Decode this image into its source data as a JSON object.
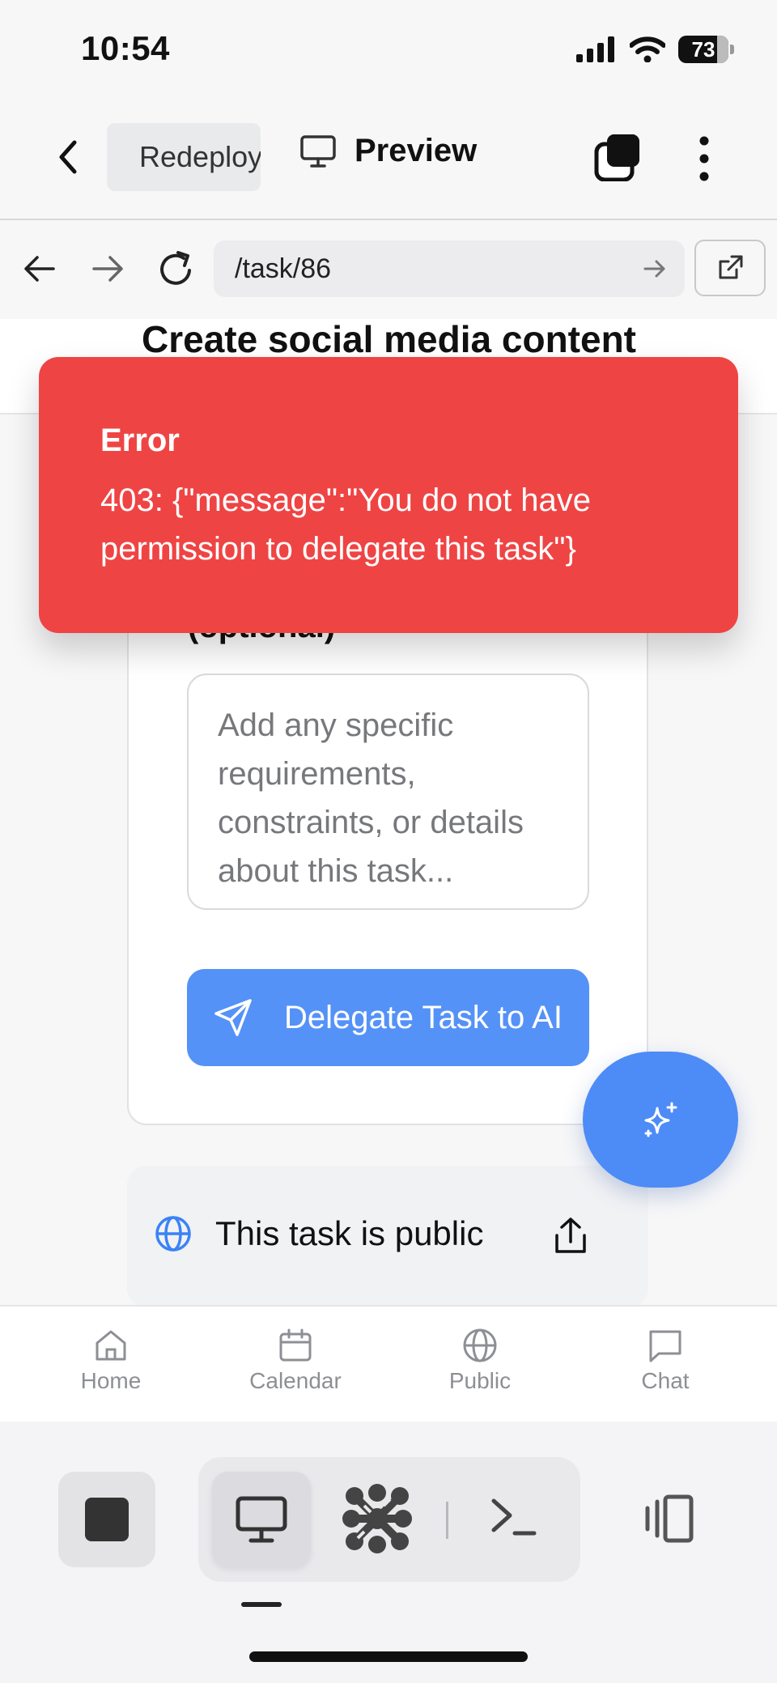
{
  "status_bar": {
    "time": "10:54",
    "battery": "73"
  },
  "app_bar": {
    "project_tab_label": "Redeploy",
    "preview_label": "Preview"
  },
  "browser": {
    "url": "/task/86"
  },
  "page": {
    "title": "Create social media content",
    "optional_label": "(optional)",
    "details_placeholder": "Add any specific requirements, constraints, or details about this task...",
    "delegate_button_label": "Delegate Task to AI",
    "public_status": "This task is public"
  },
  "error_toast": {
    "title": "Error",
    "message": "403: {\"message\":\"You do not have permission to delegate this task\"}"
  },
  "tab_bar": {
    "items": [
      {
        "label": "Home",
        "icon": "home-icon"
      },
      {
        "label": "Calendar",
        "icon": "calendar-icon"
      },
      {
        "label": "Public",
        "icon": "globe-icon"
      },
      {
        "label": "Chat",
        "icon": "chat-icon"
      }
    ]
  },
  "colors": {
    "error": "#ef4444",
    "primary": "#5592f7",
    "fab": "#4d8bf7",
    "tab_inactive": "#8d8f94"
  }
}
